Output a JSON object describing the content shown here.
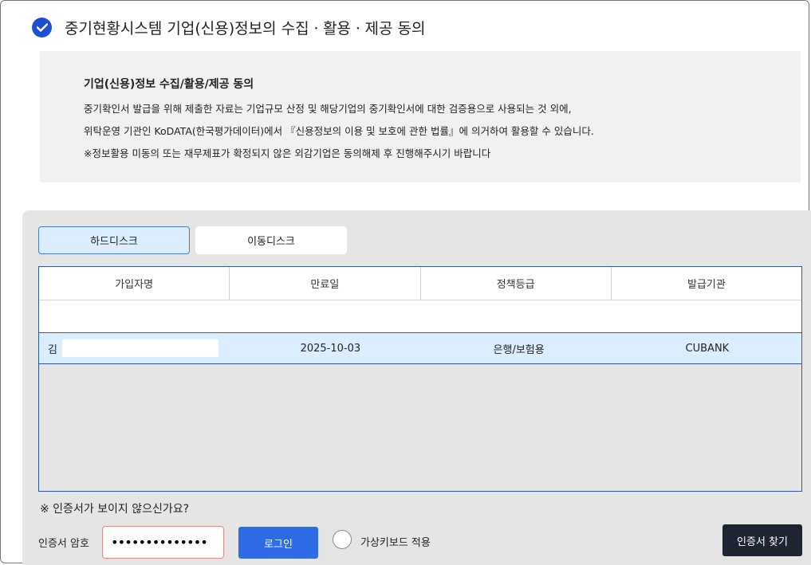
{
  "header": {
    "title": "중기현황시스템 기업(신용)정보의 수집ㆍ활용ㆍ제공 동의",
    "icon": "check-circle-icon",
    "accent_color": "#1d4fd6"
  },
  "notice": {
    "title": "기업(신용)정보 수집/활용/제공 동의",
    "lines": [
      "중기확인서 발급을 위해 제출한 자료는 기업규모 산정 및 해당기업의 중기확인서에 대한 검증용으로 사용되는 것 외에,",
      "위탁운영 기관인 KoDATA(한국평가데이터)에서 『신용정보의 이용 및 보호에 관한 법률』에 의거하여 활용할 수 있습니다.",
      "※정보활용 미동의 또는 재무제표가 확정되지 않은 외감기업은 동의해제 후 진행해주시기 바랍니다"
    ]
  },
  "tabs": [
    {
      "label": "하드디스크",
      "active": true
    },
    {
      "label": "이동디스크",
      "active": false
    }
  ],
  "table": {
    "headers": [
      "가입자명",
      "만료일",
      "정책등급",
      "발급기관"
    ],
    "rows": [
      {
        "name": "김",
        "expiry": "2025-10-03",
        "policy": "은행/보험용",
        "issuer": "CUBANK",
        "selected": true
      }
    ]
  },
  "hint": "※ 인증서가 보이지 않으신가요?",
  "password": {
    "label": "인증서 암호",
    "value": "••••••••••••••"
  },
  "login_label": "로그인",
  "virtual_keyboard_label": "가상키보드 적용",
  "find_cert_label": "인증서 찾기"
}
